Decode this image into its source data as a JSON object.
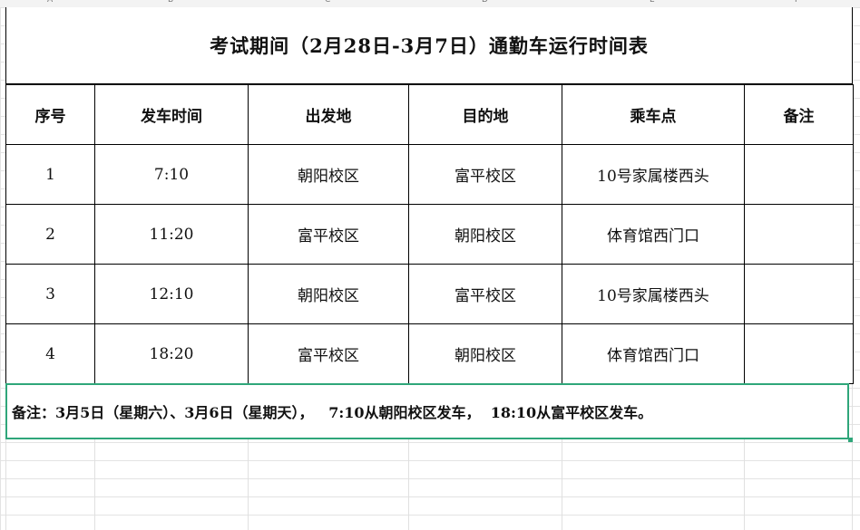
{
  "sheet": {
    "columns": [
      "A",
      "B",
      "C",
      "D",
      "E",
      "F"
    ],
    "title": "考试期间（2月28日-3月7日）通勤车运行时间表",
    "headers": {
      "no": "序号",
      "time": "发车时间",
      "origin": "出发地",
      "destination": "目的地",
      "stop": "乘车点",
      "remark": "备注"
    },
    "rows": [
      {
        "no": "1",
        "time": "7:10",
        "origin": "朝阳校区",
        "destination": "富平校区",
        "stop": "10号家属楼西头",
        "remark": ""
      },
      {
        "no": "2",
        "time": "11:20",
        "origin": "富平校区",
        "destination": "朝阳校区",
        "stop": "体育馆西门口",
        "remark": ""
      },
      {
        "no": "3",
        "time": "12:10",
        "origin": "朝阳校区",
        "destination": "富平校区",
        "stop": "10号家属楼西头",
        "remark": ""
      },
      {
        "no": "4",
        "time": "18:20",
        "origin": "富平校区",
        "destination": "朝阳校区",
        "stop": "体育馆西门口",
        "remark": ""
      }
    ],
    "note": "备注：3月5日（星期六）、3月6日（星期天），   7:10从朝阳校区发车，  18:10从富平校区发车。"
  },
  "colors": {
    "selection_border": "#2fa67a",
    "gridline": "#e3e3e3"
  }
}
